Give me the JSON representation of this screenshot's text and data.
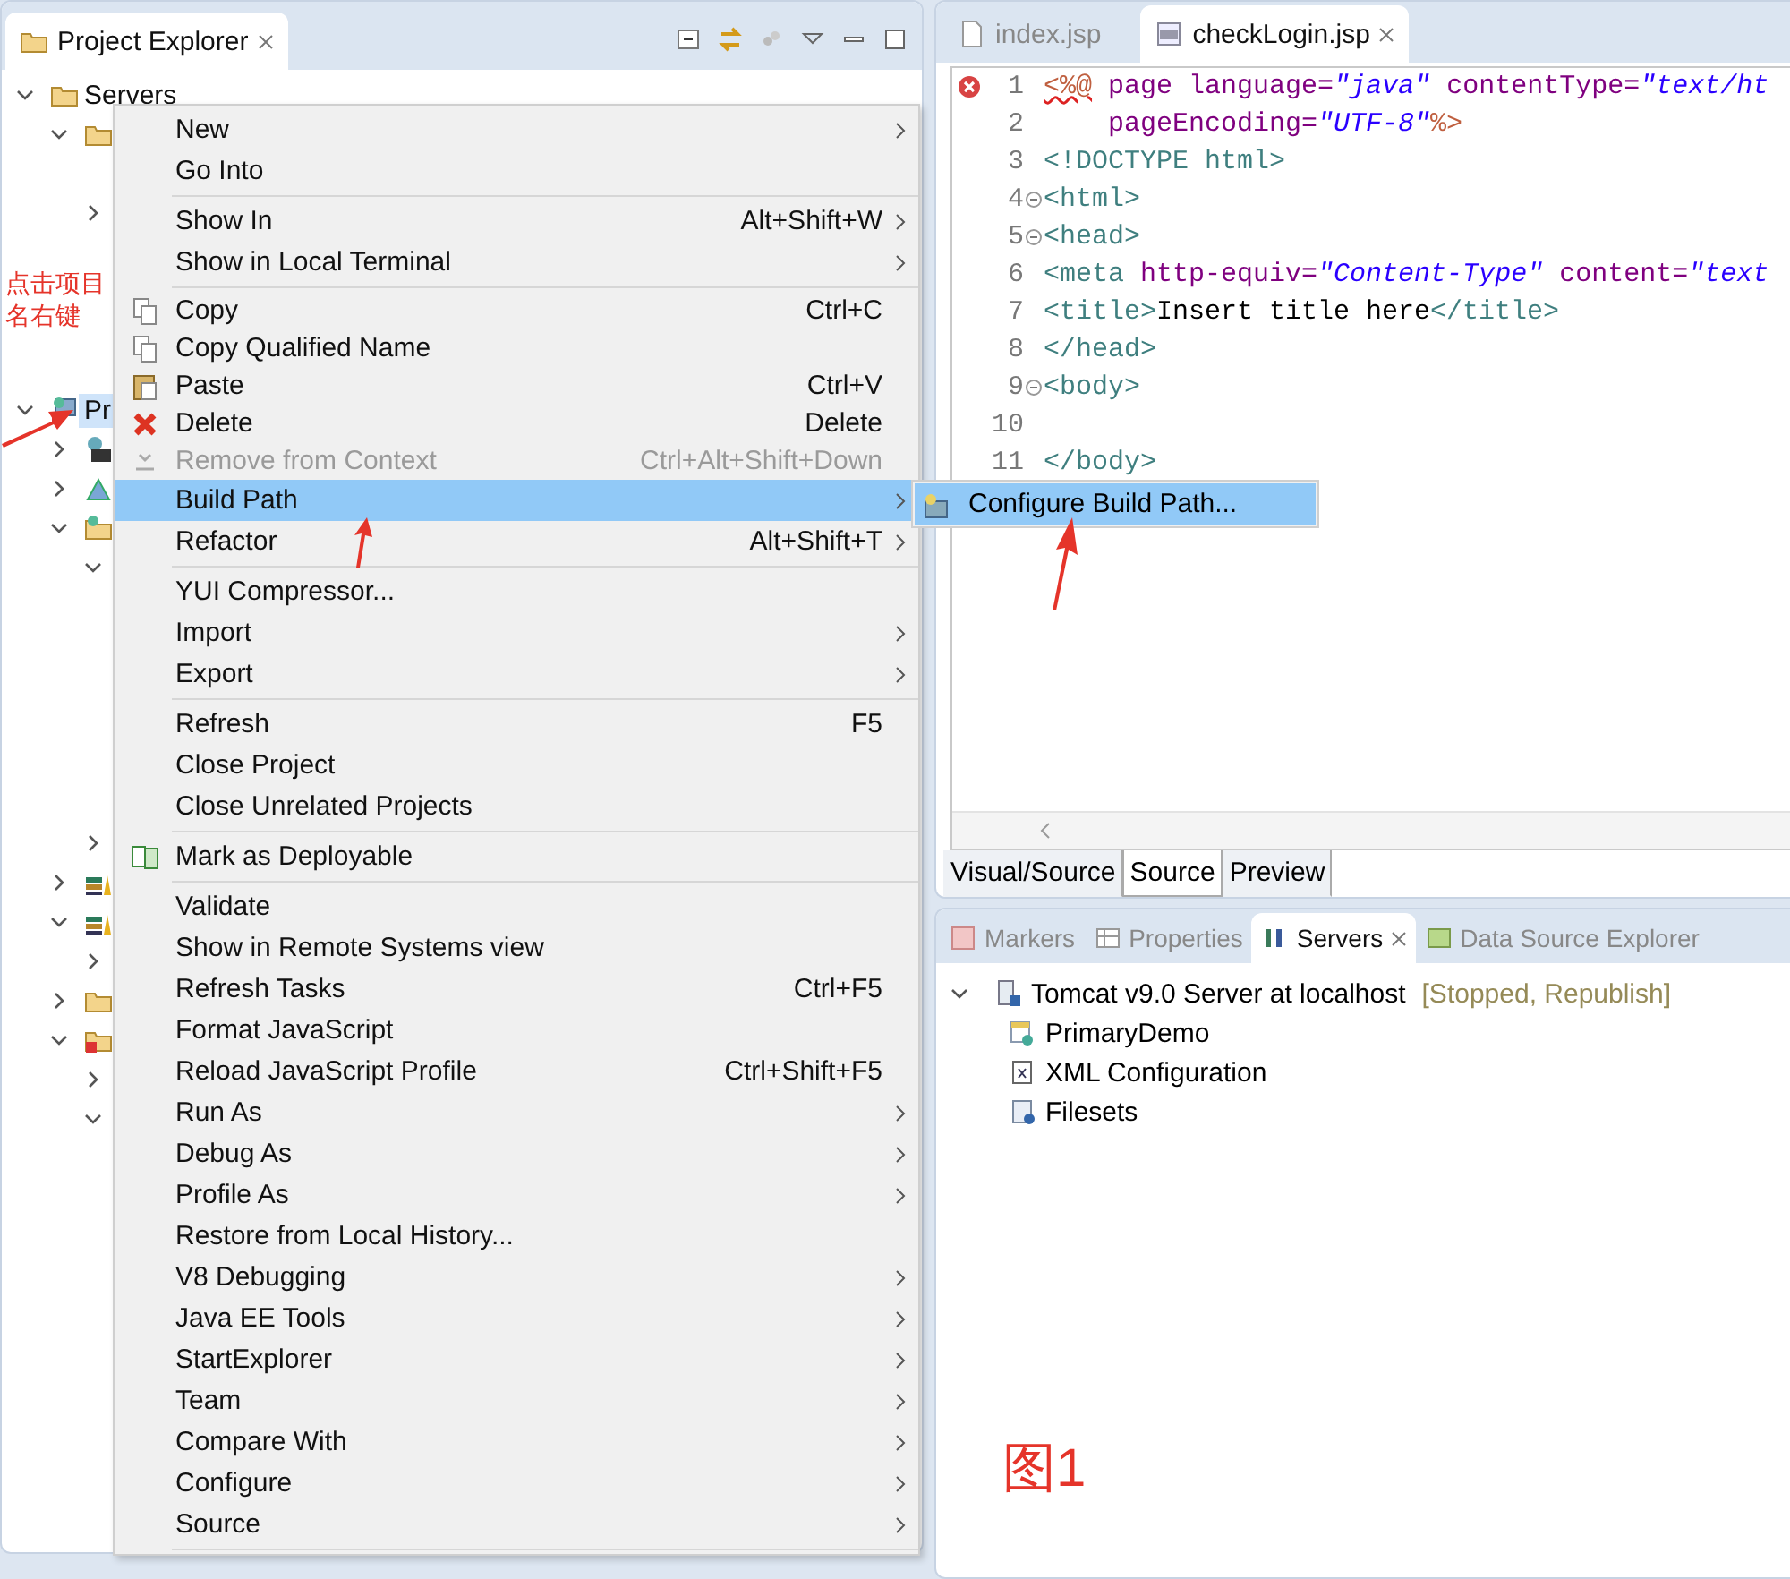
{
  "project_explorer": {
    "title": "Project Explorer",
    "tree": [
      {
        "kind": "folder",
        "label": "Servers",
        "expanded": true,
        "children": [
          {
            "kind": "folder",
            "expanded": true,
            "children": [
              {
                "expanded": false
              }
            ]
          }
        ]
      },
      {
        "kind": "project",
        "label": "Pr",
        "expanded": true,
        "selected": true,
        "children": [
          {
            "kind": "descriptor",
            "expanded": false
          },
          {
            "kind": "resources",
            "expanded": false
          },
          {
            "kind": "package",
            "expanded": true,
            "children": [
              {
                "expanded": true
              },
              {
                "expanded": false
              }
            ]
          },
          {
            "kind": "library",
            "expanded": false
          },
          {
            "kind": "library",
            "expanded": true,
            "children": [
              {
                "expanded": false
              }
            ]
          },
          {
            "kind": "folder",
            "expanded": false
          },
          {
            "kind": "error-folder",
            "expanded": true,
            "children": [
              {
                "expanded": false
              },
              {
                "expanded": true
              }
            ]
          }
        ]
      }
    ]
  },
  "context_menu": [
    {
      "kind": "item",
      "label": "New",
      "submenu": true
    },
    {
      "kind": "item",
      "label": "Go Into"
    },
    {
      "kind": "separator"
    },
    {
      "kind": "item",
      "label": "Show In",
      "shortcut": "Alt+Shift+W",
      "submenu": true
    },
    {
      "kind": "item",
      "label": "Show in Local Terminal",
      "submenu": true
    },
    {
      "kind": "separator"
    },
    {
      "kind": "copy",
      "label": "Copy",
      "shortcut": "Ctrl+C"
    },
    {
      "kind": "copy",
      "label": "Copy Qualified Name"
    },
    {
      "kind": "paste",
      "label": "Paste",
      "shortcut": "Ctrl+V"
    },
    {
      "kind": "delete",
      "label": "Delete",
      "shortcut": "Delete"
    },
    {
      "kind": "remove",
      "label": "Remove from Context",
      "shortcut": "Ctrl+Alt+Shift+Down",
      "disabled": true
    },
    {
      "kind": "item",
      "label": "Build Path",
      "submenu": true,
      "selected": true
    },
    {
      "kind": "item",
      "label": "Refactor",
      "shortcut": "Alt+Shift+T",
      "submenu": true
    },
    {
      "kind": "separator"
    },
    {
      "kind": "item",
      "label": "YUI Compressor..."
    },
    {
      "kind": "item",
      "label": "Import",
      "submenu": true
    },
    {
      "kind": "item",
      "label": "Export",
      "submenu": true
    },
    {
      "kind": "separator"
    },
    {
      "kind": "item",
      "label": "Refresh",
      "shortcut": "F5"
    },
    {
      "kind": "item",
      "label": "Close Project"
    },
    {
      "kind": "item",
      "label": "Close Unrelated Projects"
    },
    {
      "kind": "separator"
    },
    {
      "kind": "deploy",
      "label": "Mark as Deployable"
    },
    {
      "kind": "separator"
    },
    {
      "kind": "item",
      "label": "Validate"
    },
    {
      "kind": "item",
      "label": "Show in Remote Systems view"
    },
    {
      "kind": "item",
      "label": "Refresh Tasks",
      "shortcut": "Ctrl+F5"
    },
    {
      "kind": "item",
      "label": "Format JavaScript"
    },
    {
      "kind": "item",
      "label": "Reload JavaScript Profile",
      "shortcut": "Ctrl+Shift+F5"
    },
    {
      "kind": "item",
      "label": "Run As",
      "submenu": true
    },
    {
      "kind": "item",
      "label": "Debug As",
      "submenu": true
    },
    {
      "kind": "item",
      "label": "Profile As",
      "submenu": true
    },
    {
      "kind": "item",
      "label": "Restore from Local History..."
    },
    {
      "kind": "item",
      "label": "V8 Debugging",
      "submenu": true
    },
    {
      "kind": "item",
      "label": "Java EE Tools",
      "submenu": true
    },
    {
      "kind": "item",
      "label": "StartExplorer",
      "submenu": true
    },
    {
      "kind": "item",
      "label": "Team",
      "submenu": true
    },
    {
      "kind": "item",
      "label": "Compare With",
      "submenu": true
    },
    {
      "kind": "item",
      "label": "Configure",
      "submenu": true
    },
    {
      "kind": "item",
      "label": "Source",
      "submenu": true
    },
    {
      "kind": "separator"
    }
  ],
  "submenu": [
    {
      "kind": "build-path",
      "label": "Configure Build Path...",
      "selected": true
    }
  ],
  "editor": {
    "tabs": [
      {
        "label": "index.jsp",
        "selected": false
      },
      {
        "label": "checkLogin.jsp",
        "selected": true
      }
    ],
    "lines": [
      {
        "number": "1",
        "kind": "error",
        "tokens": [
          {
            "kind": "directive-error",
            "text": "<%@"
          },
          {
            "kind": "attr",
            "text": " page language="
          },
          {
            "kind": "value",
            "text": "\"java\""
          },
          {
            "kind": "attr",
            "text": " contentType="
          },
          {
            "kind": "value",
            "text": "\"text/ht"
          }
        ]
      },
      {
        "number": "2",
        "kind": "plain",
        "tokens": [
          {
            "kind": "attr",
            "text": "    pageEncoding="
          },
          {
            "kind": "value",
            "text": "\"UTF-8\""
          },
          {
            "kind": "directive",
            "text": "%>"
          }
        ]
      },
      {
        "number": "3",
        "kind": "plain",
        "tokens": [
          {
            "kind": "doctype",
            "text": "<!DOCTYPE"
          },
          {
            "kind": "tag",
            "text": " html>"
          }
        ]
      },
      {
        "number": "4",
        "kind": "fold",
        "tokens": [
          {
            "kind": "tag",
            "text": "<html>"
          }
        ]
      },
      {
        "number": "5",
        "kind": "fold",
        "tokens": [
          {
            "kind": "tag",
            "text": "<head>"
          }
        ]
      },
      {
        "number": "6",
        "kind": "plain",
        "tokens": [
          {
            "kind": "tag",
            "text": "<meta"
          },
          {
            "kind": "attr",
            "text": " http-equiv="
          },
          {
            "kind": "value",
            "text": "\"Content-Type\""
          },
          {
            "kind": "attr",
            "text": " content="
          },
          {
            "kind": "value",
            "text": "\"text"
          }
        ]
      },
      {
        "number": "7",
        "kind": "plain",
        "tokens": [
          {
            "kind": "tag",
            "text": "<title>"
          },
          {
            "kind": "text",
            "text": "Insert title here"
          },
          {
            "kind": "tag",
            "text": "</title>"
          }
        ]
      },
      {
        "number": "8",
        "kind": "plain",
        "tokens": [
          {
            "kind": "tag",
            "text": "</head>"
          }
        ]
      },
      {
        "number": "9",
        "kind": "fold",
        "tokens": [
          {
            "kind": "tag",
            "text": "<body>"
          }
        ]
      },
      {
        "number": "10",
        "kind": "plain"
      },
      {
        "number": "11",
        "kind": "plain",
        "tokens": [
          {
            "kind": "tag",
            "text": "</body>"
          }
        ]
      }
    ],
    "view_tabs": [
      {
        "label": "Visual/Source",
        "selected": false
      },
      {
        "label": "Source",
        "selected": true
      },
      {
        "label": "Preview",
        "selected": false
      }
    ]
  },
  "servers_panel": {
    "tabs": [
      {
        "kind": "markers",
        "label": "Markers",
        "selected": false
      },
      {
        "kind": "properties",
        "label": "Properties",
        "selected": false
      },
      {
        "kind": "servers",
        "label": "Servers",
        "selected": true
      },
      {
        "kind": "datasource",
        "label": "Data Source Explorer",
        "selected": false
      }
    ],
    "server": {
      "label": "Tomcat v9.0 Server at localhost",
      "status": "[Stopped, Republish]",
      "expanded": true,
      "children": [
        {
          "kind": "module",
          "label": "PrimaryDemo"
        },
        {
          "kind": "xml",
          "label": "XML Configuration"
        },
        {
          "kind": "fileset",
          "label": "Filesets"
        }
      ]
    }
  },
  "annotations": [
    {
      "kind": "note",
      "text": "点击项目名右键"
    },
    {
      "kind": "caption",
      "text": "图1"
    }
  ]
}
